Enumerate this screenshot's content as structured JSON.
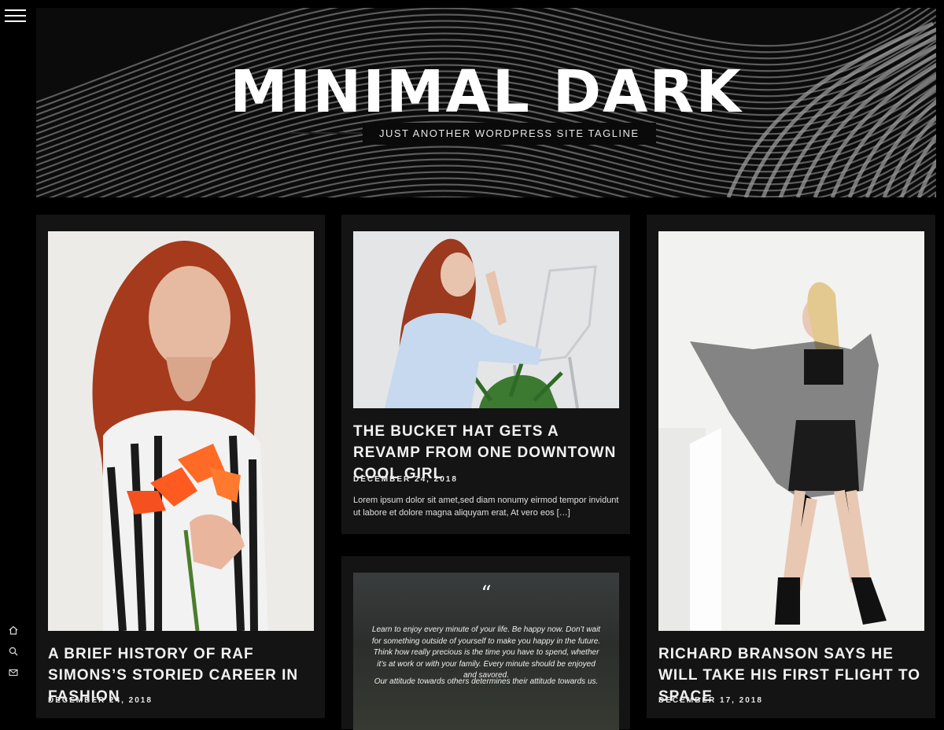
{
  "site": {
    "title": "MINIMAL DARK",
    "tagline": "JUST ANOTHER WORDPRESS SITE TAGLINE"
  },
  "sidebar": {
    "icons": [
      "menu-icon",
      "home-icon",
      "search-icon",
      "mail-icon"
    ]
  },
  "posts": [
    {
      "title": "A BRIEF HISTORY OF RAF SIMONS’S STORIED CAREER IN FASHION",
      "date": "DECEMBER 24, 2018"
    },
    {
      "title": "THE BUCKET HAT GETS A REVAMP FROM ONE DOWNTOWN COOL GIRL",
      "date": "DECEMBER 24, 2018",
      "excerpt": "Lorem ipsum dolor sit amet,sed diam nonumy eirmod tempor invidunt ut labore et dolore magna aliquyam erat, At vero eos […]"
    },
    {
      "quote_mark": "“",
      "quote": "Learn to enjoy every minute of your life. Be happy now. Don’t wait for something outside of yourself to make you happy in the future. Think how really precious is the time you have to spend, whether it’s at work or with your family. Every minute should be enjoyed and savored.",
      "quote_sub": "Our attitude towards others determines their attitude towards us."
    },
    {
      "title": "RICHARD BRANSON SAYS HE WILL TAKE HIS FIRST FLIGHT TO SPACE",
      "date": "DECEMBER 17, 2018"
    }
  ],
  "colors": {
    "background": "#000000",
    "card": "#141414",
    "text": "#ffffff"
  }
}
